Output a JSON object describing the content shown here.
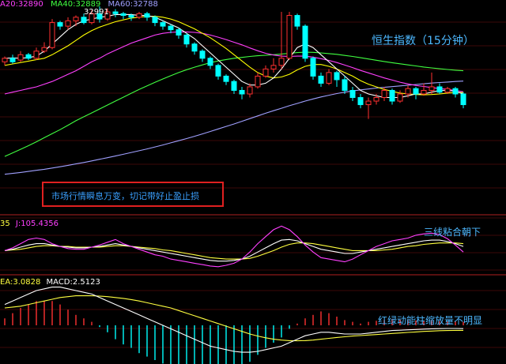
{
  "legend_top": {
    "ma20": "A20:32890",
    "ma40": "MA40:32889",
    "ma60": "MA60:32788",
    "colors": {
      "ma20": "#ff40ff",
      "ma40": "#40ff40",
      "ma60": "#a0a0ff"
    }
  },
  "price_high_label": "32991",
  "panel_title": "恒生指数（15分钟）",
  "warning": "市场行情瞬息万变，切记带好止盈止损",
  "kdj_legend": {
    "part1": "35",
    "part2": "J:105.4356",
    "colors": {
      "part1": "#ffff40",
      "part2": "#ff40ff"
    }
  },
  "kdj_note": "三线粘合朝下",
  "macd_legend": {
    "dea": "EA:3.0828",
    "macd": "MACD:2.5123",
    "colors": {
      "dea": "#ffff40",
      "macd": "#ffffff"
    }
  },
  "macd_note": "红绿动能柱缩放量不明显",
  "chart_data": {
    "type": "candlestick",
    "colors": {
      "up": "#ff3030",
      "down": "#00ffff",
      "ma5": "#ffffff",
      "ma10": "#ffff00",
      "ma20": "#ff40ff",
      "ma40": "#40ff40",
      "ma60": "#a0a0ff",
      "grid": "#7a1010"
    },
    "candles": [
      [
        32680,
        32700,
        32660,
        32710
      ],
      [
        32700,
        32680,
        32670,
        32720
      ],
      [
        32690,
        32720,
        32680,
        32740
      ],
      [
        32720,
        32700,
        32690,
        32730
      ],
      [
        32700,
        32740,
        32690,
        32760
      ],
      [
        32740,
        32760,
        32730,
        32790
      ],
      [
        32760,
        32900,
        32750,
        32920
      ],
      [
        32900,
        32880,
        32860,
        32910
      ],
      [
        32880,
        32910,
        32860,
        32930
      ],
      [
        32910,
        32930,
        32880,
        32940
      ],
      [
        32930,
        32900,
        32890,
        32950
      ],
      [
        32900,
        32950,
        32890,
        32970
      ],
      [
        32950,
        32920,
        32900,
        32991
      ],
      [
        32920,
        32960,
        32910,
        32980
      ],
      [
        32960,
        32950,
        32930,
        32975
      ],
      [
        32950,
        32940,
        32920,
        32960
      ],
      [
        32940,
        32930,
        32910,
        32950
      ],
      [
        32930,
        32950,
        32920,
        32960
      ],
      [
        32950,
        32930,
        32910,
        32960
      ],
      [
        32930,
        32900,
        32880,
        32940
      ],
      [
        32900,
        32880,
        32860,
        32910
      ],
      [
        32880,
        32860,
        32840,
        32890
      ],
      [
        32860,
        32830,
        32810,
        32870
      ],
      [
        32830,
        32780,
        32760,
        32840
      ],
      [
        32780,
        32740,
        32720,
        32790
      ],
      [
        32740,
        32700,
        32680,
        32750
      ],
      [
        32700,
        32660,
        32640,
        32710
      ],
      [
        32660,
        32600,
        32580,
        32670
      ],
      [
        32600,
        32570,
        32550,
        32610
      ],
      [
        32570,
        32520,
        32500,
        32580
      ],
      [
        32520,
        32500,
        32470,
        32540
      ],
      [
        32500,
        32540,
        32480,
        32560
      ],
      [
        32540,
        32600,
        32530,
        32620
      ],
      [
        32600,
        32640,
        32590,
        32660
      ],
      [
        32640,
        32660,
        32620,
        32700
      ],
      [
        32660,
        32700,
        32640,
        32960
      ],
      [
        32700,
        32940,
        32690,
        32960
      ],
      [
        32940,
        32880,
        32860,
        32950
      ],
      [
        32880,
        32700,
        32680,
        32890
      ],
      [
        32700,
        32600,
        32580,
        32710
      ],
      [
        32600,
        32560,
        32540,
        32620
      ],
      [
        32560,
        32620,
        32550,
        32640
      ],
      [
        32620,
        32580,
        32540,
        32630
      ],
      [
        32580,
        32520,
        32500,
        32600
      ],
      [
        32520,
        32480,
        32460,
        32540
      ],
      [
        32480,
        32440,
        32420,
        32500
      ],
      [
        32440,
        32460,
        32360,
        32480
      ],
      [
        32460,
        32480,
        32440,
        32500
      ],
      [
        32480,
        32520,
        32460,
        32540
      ],
      [
        32520,
        32460,
        32440,
        32530
      ],
      [
        32460,
        32500,
        32450,
        32520
      ],
      [
        32500,
        32530,
        32480,
        32550
      ],
      [
        32530,
        32500,
        32470,
        32540
      ],
      [
        32500,
        32520,
        32490,
        32560
      ],
      [
        32520,
        32540,
        32500,
        32620
      ],
      [
        32540,
        32510,
        32500,
        32560
      ],
      [
        32510,
        32530,
        32500,
        32540
      ],
      [
        32530,
        32500,
        32480,
        32540
      ],
      [
        32500,
        32440,
        32420,
        32510
      ]
    ],
    "ma5": [
      32700,
      32702,
      32700,
      32704,
      32712,
      32740,
      32780,
      32820,
      32860,
      32890,
      32910,
      32920,
      32930,
      32935,
      32945,
      32945,
      32945,
      32940,
      32940,
      32930,
      32910,
      32890,
      32870,
      32840,
      32810,
      32770,
      32730,
      32690,
      32650,
      32610,
      32570,
      32550,
      32550,
      32560,
      32590,
      32640,
      32700,
      32760,
      32780,
      32760,
      32720,
      32680,
      32640,
      32600,
      32560,
      32520,
      32500,
      32490,
      32480,
      32480,
      32480,
      32490,
      32500,
      32500,
      32510,
      32520,
      32520,
      32515,
      32500
    ],
    "ma10": [
      32660,
      32668,
      32676,
      32684,
      32692,
      32700,
      32720,
      32745,
      32770,
      32800,
      32830,
      32855,
      32875,
      32890,
      32905,
      32915,
      32925,
      32930,
      32935,
      32935,
      32930,
      32920,
      32905,
      32885,
      32865,
      32840,
      32815,
      32785,
      32755,
      32720,
      32685,
      32650,
      32620,
      32600,
      32590,
      32595,
      32610,
      32635,
      32655,
      32665,
      32665,
      32655,
      32640,
      32620,
      32600,
      32575,
      32555,
      32540,
      32525,
      32515,
      32505,
      32500,
      32497,
      32495,
      32497,
      32500,
      32505,
      32508,
      32508
    ],
    "ma20": [
      32500,
      32510,
      32520,
      32530,
      32540,
      32555,
      32570,
      32590,
      32610,
      32630,
      32655,
      32680,
      32700,
      32725,
      32745,
      32765,
      32785,
      32800,
      32815,
      32830,
      32840,
      32845,
      32848,
      32848,
      32845,
      32840,
      32830,
      32818,
      32805,
      32790,
      32775,
      32758,
      32742,
      32728,
      32718,
      32712,
      32710,
      32712,
      32712,
      32706,
      32698,
      32688,
      32676,
      32662,
      32648,
      32632,
      32618,
      32604,
      32590,
      32578,
      32566,
      32556,
      32548,
      32542,
      32536,
      32530,
      32525,
      32520,
      32512
    ],
    "ma40": [
      32150,
      32170,
      32190,
      32210,
      32232,
      32255,
      32278,
      32300,
      32325,
      32350,
      32372,
      32394,
      32416,
      32438,
      32460,
      32482,
      32504,
      32525,
      32545,
      32565,
      32584,
      32602,
      32620,
      32636,
      32650,
      32663,
      32675,
      32685,
      32693,
      32700,
      32705,
      32710,
      32714,
      32717,
      32720,
      32724,
      32728,
      32732,
      32734,
      32733,
      32730,
      32726,
      32722,
      32716,
      32710,
      32703,
      32696,
      32689,
      32682,
      32675,
      32669,
      32663,
      32657,
      32651,
      32646,
      32641,
      32637,
      32633,
      32630
    ],
    "ma60": [
      32050,
      32055,
      32060,
      32066,
      32072,
      32078,
      32085,
      32092,
      32100,
      32108,
      32116,
      32125,
      32134,
      32143,
      32152,
      32162,
      32172,
      32182,
      32192,
      32203,
      32214,
      32226,
      32238,
      32250,
      32263,
      32276,
      32290,
      32304,
      32318,
      32332,
      32347,
      32362,
      32377,
      32392,
      32406,
      32420,
      32434,
      32447,
      32460,
      32472,
      32483,
      32493,
      32502,
      32510,
      32517,
      32523,
      32528,
      32533,
      32537,
      32541,
      32545,
      32549,
      32553,
      32557,
      32561,
      32564,
      32567,
      32570,
      32572
    ],
    "kdj": {
      "k": [
        40,
        42,
        45,
        48,
        50,
        50,
        48,
        46,
        45,
        44,
        44,
        45,
        46,
        48,
        50,
        48,
        46,
        44,
        42,
        40,
        38,
        36,
        34,
        32,
        30,
        28,
        26,
        25,
        25,
        26,
        28,
        32,
        38,
        44,
        50,
        55,
        56,
        54,
        50,
        46,
        42,
        40,
        38,
        36,
        36,
        38,
        40,
        42,
        44,
        46,
        48,
        50,
        52,
        54,
        55,
        55,
        53,
        50,
        46
      ],
      "d": [
        40,
        41,
        42,
        44,
        46,
        47,
        47,
        46,
        46,
        45,
        45,
        45,
        45,
        46,
        47,
        47,
        46,
        45,
        44,
        43,
        41,
        40,
        38,
        36,
        34,
        32,
        30,
        29,
        28,
        28,
        28,
        29,
        32,
        36,
        40,
        45,
        49,
        51,
        51,
        50,
        48,
        46,
        44,
        42,
        40,
        40,
        40,
        40,
        41,
        42,
        44,
        46,
        47,
        49,
        50,
        51,
        51,
        51,
        50
      ],
      "j": [
        40,
        44,
        50,
        56,
        58,
        56,
        50,
        46,
        43,
        42,
        42,
        45,
        48,
        52,
        56,
        50,
        46,
        42,
        38,
        34,
        32,
        28,
        26,
        24,
        22,
        20,
        18,
        17,
        19,
        22,
        28,
        38,
        50,
        60,
        70,
        75,
        70,
        60,
        48,
        38,
        30,
        28,
        26,
        24,
        28,
        34,
        40,
        46,
        50,
        54,
        56,
        58,
        62,
        64,
        65,
        63,
        57,
        48,
        38
      ]
    },
    "macd": {
      "dif": [
        12,
        14,
        16,
        18,
        20,
        21,
        22,
        22,
        21,
        20,
        19,
        18,
        16,
        14,
        12,
        10,
        8,
        6,
        4,
        2,
        0,
        -2,
        -4,
        -6,
        -8,
        -10,
        -12,
        -13,
        -14,
        -15,
        -15.5,
        -15.5,
        -15,
        -14,
        -13,
        -12,
        -10,
        -8,
        -6,
        -5,
        -4,
        -4,
        -4.5,
        -5,
        -5,
        -5,
        -4.5,
        -4,
        -3.5,
        -3,
        -2.8,
        -2.6,
        -2.4,
        -2.2,
        -2,
        -1.9,
        -1.8,
        -1.8,
        -1.9
      ],
      "dea": [
        10,
        10.5,
        11,
        12,
        13,
        14,
        15,
        16,
        16.5,
        17,
        17,
        17,
        16.8,
        16.5,
        16,
        15.5,
        14.8,
        14,
        13,
        12,
        11,
        10,
        8.5,
        7,
        5.5,
        4,
        2.5,
        1,
        -0.5,
        -2,
        -3.5,
        -5,
        -6.2,
        -7.2,
        -8,
        -8.5,
        -8.8,
        -8.9,
        -8.8,
        -8.5,
        -8,
        -7.5,
        -7,
        -6.6,
        -6.2,
        -5.9,
        -5.6,
        -5.3,
        -5,
        -4.7,
        -4.4,
        -4.1,
        -3.8,
        -3.5,
        -3.3,
        -3.1,
        -3,
        -2.9,
        -2.9
      ],
      "hist": [
        4,
        7,
        10,
        12,
        14,
        14,
        14,
        12,
        9,
        6,
        4,
        2,
        -1,
        -4,
        -8,
        -11,
        -13,
        -16,
        -18,
        -20,
        -22,
        -24,
        -25,
        -26,
        -27,
        -28,
        -29,
        -28,
        -27,
        -26,
        -24,
        -21,
        -17,
        -13,
        -10,
        -7,
        -2,
        1,
        4,
        6,
        8,
        7,
        5,
        3,
        2,
        1,
        2,
        2.6,
        3,
        3.4,
        3.2,
        3,
        2.8,
        2.6,
        2.6,
        2.4,
        2.4,
        2.2,
        2
      ]
    }
  }
}
